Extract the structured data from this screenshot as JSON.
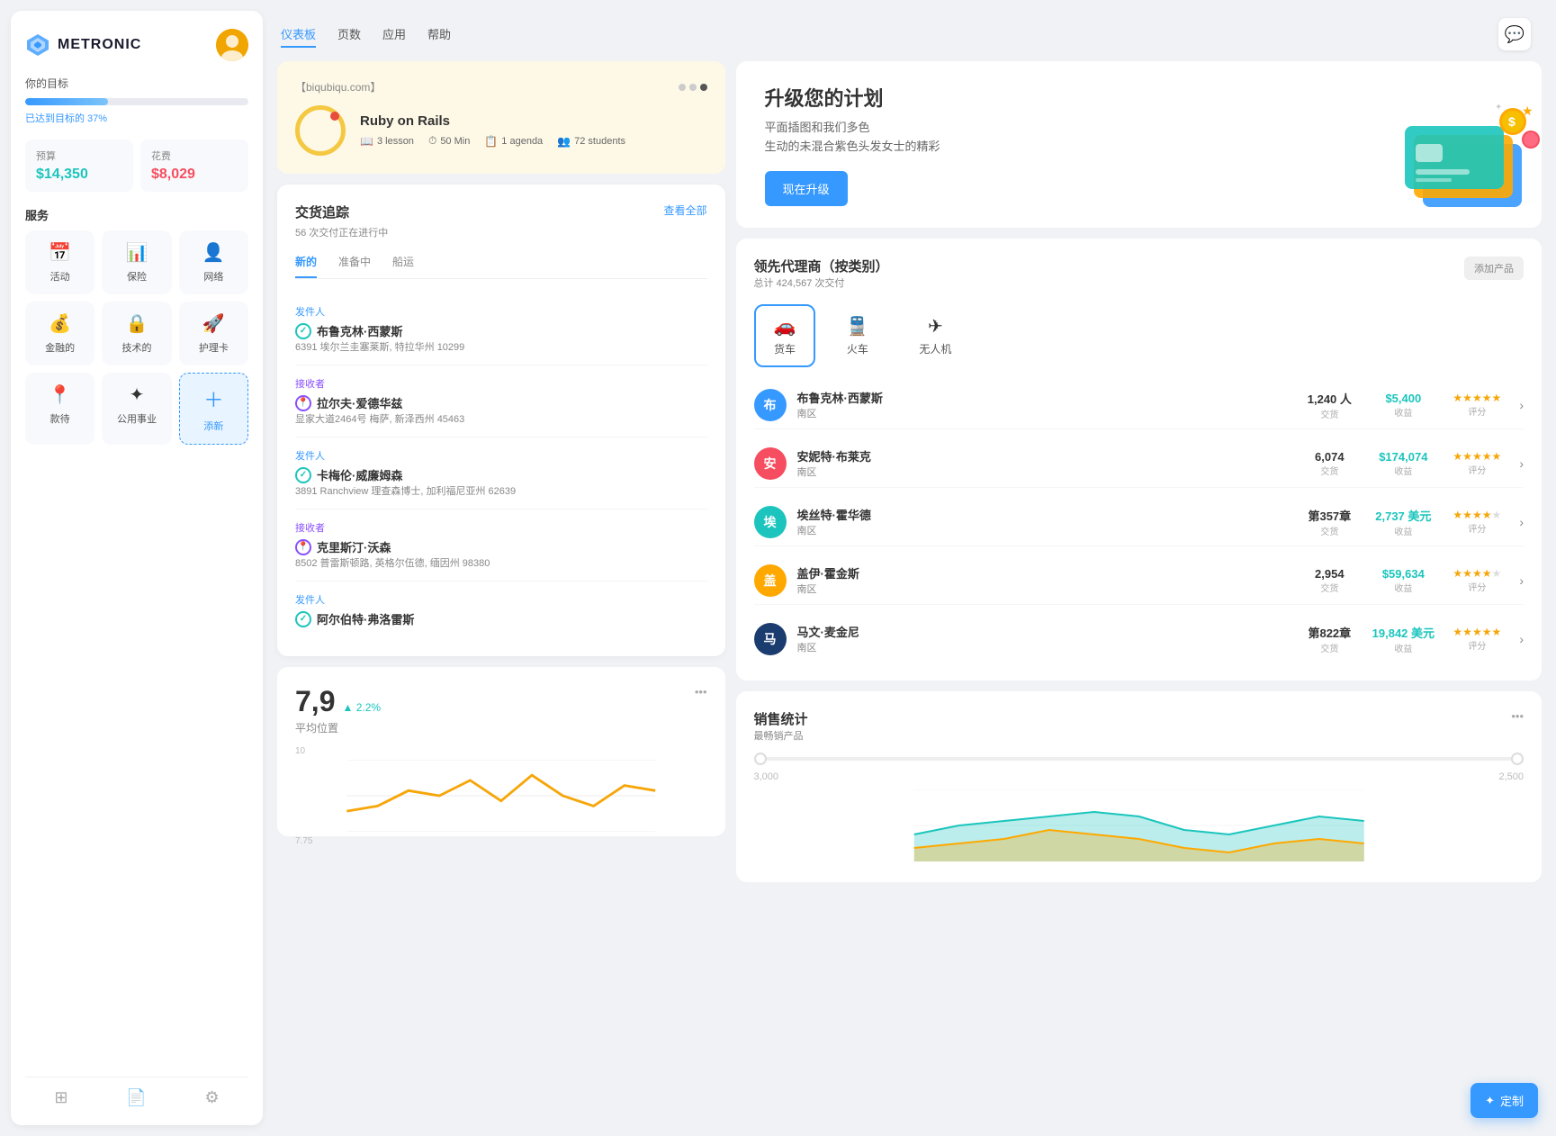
{
  "sidebar": {
    "logo_text": "METRONIC",
    "goal": {
      "label": "你的目标",
      "pct": 37,
      "pct_label": "已达到目标的 37%"
    },
    "budget": {
      "label": "预算",
      "value": "$14,350"
    },
    "spend": {
      "label": "花费",
      "value": "$8,029"
    },
    "services_label": "服务",
    "services": [
      {
        "name": "活动",
        "icon": "📅"
      },
      {
        "name": "保险",
        "icon": "📊"
      },
      {
        "name": "网络",
        "icon": "👤"
      },
      {
        "name": "金融的",
        "icon": "💰"
      },
      {
        "name": "技术的",
        "icon": "🔒"
      },
      {
        "name": "护理卡",
        "icon": "🚀"
      },
      {
        "name": "款待",
        "icon": "📍"
      },
      {
        "name": "公用事业",
        "icon": "✦"
      },
      {
        "name": "添新",
        "icon": "＋",
        "is_add": true
      }
    ]
  },
  "nav": {
    "links": [
      "仪表板",
      "页数",
      "应用",
      "帮助"
    ],
    "active_index": 0
  },
  "course_card": {
    "url": "【biqubiqu.com】",
    "title": "Ruby on Rails",
    "meta": [
      {
        "icon": "📖",
        "text": "3 lesson"
      },
      {
        "icon": "⏱",
        "text": "50 Min"
      },
      {
        "icon": "📋",
        "text": "1 agenda"
      },
      {
        "icon": "👥",
        "text": "72 students"
      }
    ],
    "dots": 3
  },
  "upgrade_card": {
    "title": "升级您的计划",
    "desc_line1": "平面插图和我们多色",
    "desc_line2": "生动的未混合紫色头发女士的精彩",
    "btn_label": "现在升级"
  },
  "delivery": {
    "title": "交货追踪",
    "subtitle": "56 次交付正在进行中",
    "view_all": "查看全部",
    "tabs": [
      "新的",
      "准备中",
      "船运"
    ],
    "active_tab": 0,
    "items": [
      {
        "role": "发件人",
        "name": "布鲁克林·西蒙斯",
        "addr": "6391 埃尔兰圭塞莱斯, 特拉华州 10299",
        "icon_type": "green"
      },
      {
        "role": "接收者",
        "name": "拉尔夫·爱德华兹",
        "addr": "显家大道2464号 梅萨, 新泽西州 45463",
        "icon_type": "purple"
      },
      {
        "role": "发件人",
        "name": "卡梅伦·威廉姆森",
        "addr": "3891 Ranchview 理查森博士, 加利福尼亚州 62639",
        "icon_type": "green"
      },
      {
        "role": "接收者",
        "name": "克里斯汀·沃森",
        "addr": "8502 普雷斯顿路, 英格尔伍德, 缅因州 98380",
        "icon_type": "purple"
      },
      {
        "role": "发件人",
        "name": "阿尔伯特·弗洛雷斯",
        "addr": "",
        "icon_type": "green"
      }
    ]
  },
  "agents": {
    "title": "领先代理商（按类别）",
    "subtitle": "总计 424,567 次交付",
    "add_btn": "添加产品",
    "tabs": [
      {
        "icon": "🚗",
        "label": "货车"
      },
      {
        "icon": "🚆",
        "label": "火车"
      },
      {
        "icon": "✈",
        "label": "无人机"
      }
    ],
    "active_tab": 0,
    "list": [
      {
        "name": "布鲁克林·西蒙斯",
        "region": "南区",
        "transactions": "1,240 人",
        "trans_label": "交货",
        "revenue": "$5,400",
        "rev_label": "收益",
        "stars": 5,
        "rating_label": "评分",
        "color": "av-blue"
      },
      {
        "name": "安妮特·布莱克",
        "region": "南区",
        "transactions": "6,074",
        "trans_label": "交货",
        "revenue": "$174,074",
        "rev_label": "收益",
        "stars": 5,
        "rating_label": "评分",
        "color": "av-pink"
      },
      {
        "name": "埃丝特·霍华德",
        "region": "南区",
        "transactions": "第357章",
        "trans_label": "交货",
        "revenue": "2,737 美元",
        "rev_label": "收益",
        "stars": 4,
        "rating_label": "评分",
        "color": "av-teal"
      },
      {
        "name": "盖伊·霍金斯",
        "region": "南区",
        "transactions": "2,954",
        "trans_label": "交货",
        "revenue": "$59,634",
        "rev_label": "收益",
        "stars": 4,
        "rating_label": "评分",
        "color": "av-orange"
      },
      {
        "name": "马文·麦金尼",
        "region": "南区",
        "transactions": "第822章",
        "trans_label": "交货",
        "revenue": "19,842 美元",
        "rev_label": "收益",
        "stars": 5,
        "rating_label": "评分",
        "color": "av-navy"
      }
    ]
  },
  "stats": {
    "number": "7,9",
    "change": "▲ 2.2%",
    "label": "平均位置",
    "y_max": "10",
    "y_mid": "7.75"
  },
  "sales": {
    "title": "销售统计",
    "subtitle": "最畅销产品",
    "y_max": "3,000",
    "y_mid": "2,500"
  },
  "customize": {
    "btn_label": "定制"
  }
}
